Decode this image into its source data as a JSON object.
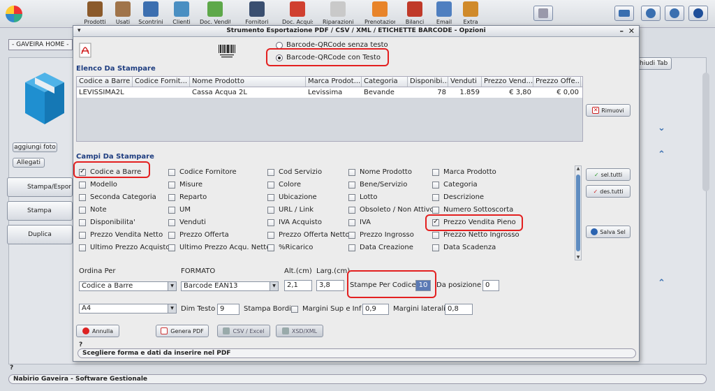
{
  "toolbar": {
    "items": [
      {
        "label": "Prodotti",
        "color": "#8b5a2b"
      },
      {
        "label": "Usati",
        "color": "#a0744a"
      },
      {
        "label": "Scontrini",
        "color": "#3c6fb0"
      },
      {
        "label": "Clienti",
        "color": "#4a8fc2"
      },
      {
        "label": "Doc. Vendita",
        "color": "#5ea84a"
      },
      {
        "label": "Fornitori",
        "color": "#3a4f70"
      },
      {
        "label": "Doc. Acquisto",
        "color": "#d04030"
      },
      {
        "label": "Riparazioni",
        "color": "#c9c9c9"
      },
      {
        "label": "Prenotazioni",
        "color": "#e8842a"
      },
      {
        "label": "Bilanci",
        "color": "#c03a2a"
      },
      {
        "label": "Email",
        "color": "#4f7fc0"
      },
      {
        "label": "Extra",
        "color": "#d08a2a"
      }
    ],
    "right_buttons": [
      "printer-icon",
      "keyboard-icon",
      "settings-icon",
      "minimize-icon",
      "power-icon"
    ]
  },
  "background": {
    "home_tab": "- GAVEIRA HOME -",
    "add_photo": "aggiungi foto",
    "attachments": "Allegati",
    "print_export": "Stampa/Espor",
    "print_labels": "Stampa Etichet",
    "duplicate": "Duplica",
    "close_tab": "Chiudi Tab",
    "status_q": "?",
    "status": "Nabirio Gaveira - Software Gestionale"
  },
  "dialog": {
    "title": "Strumento Esportazione PDF / CSV / XML / ETICHETTE BARCODE - Opzioni",
    "barcode_options": [
      {
        "label": "Barcode-QRCode senza testo",
        "selected": false
      },
      {
        "label": "Barcode-QRCode con Testo",
        "selected": true
      }
    ],
    "list_title": "Elenco Da Stampare",
    "table": {
      "columns": [
        "Codice a Barre",
        "Codice Fornit...",
        "Nome Prodotto",
        "Marca Prodot...",
        "Categoria",
        "Disponibi...",
        "Venduti",
        "Prezzo Vend...",
        "Prezzo Offe..."
      ],
      "rows": [
        [
          "LEVISSIMA2L",
          "",
          "Cassa Acqua 2L",
          "Levissima",
          "Bevande",
          "78",
          "1.859",
          "€ 3,80",
          "€ 0,00"
        ]
      ]
    },
    "remove_button": "Rimuovi",
    "fields_title": "Campi Da Stampare",
    "fields": [
      [
        {
          "label": "Codice a Barre",
          "checked": true
        },
        {
          "label": "Modello",
          "checked": false
        },
        {
          "label": "Seconda Categoria",
          "checked": false
        },
        {
          "label": "Note",
          "checked": false
        },
        {
          "label": "Disponibilita'",
          "checked": false
        },
        {
          "label": "Prezzo Vendita Netto",
          "checked": false
        },
        {
          "label": "Ultimo Prezzo Acquisto",
          "checked": false
        }
      ],
      [
        {
          "label": "Codice Fornitore",
          "checked": false
        },
        {
          "label": "Misure",
          "checked": false
        },
        {
          "label": "Reparto",
          "checked": false
        },
        {
          "label": "UM",
          "checked": false
        },
        {
          "label": "Venduti",
          "checked": false
        },
        {
          "label": "Prezzo Offerta",
          "checked": false
        },
        {
          "label": "Ultimo Prezzo Acqu. Netto",
          "checked": false
        }
      ],
      [
        {
          "label": "Cod Servizio",
          "checked": false
        },
        {
          "label": "Colore",
          "checked": false
        },
        {
          "label": "Ubicazione",
          "checked": false
        },
        {
          "label": "URL / Link",
          "checked": false
        },
        {
          "label": "IVA Acquisto",
          "checked": false
        },
        {
          "label": "Prezzo Offerta Netto",
          "checked": false
        },
        {
          "label": "%Ricarico",
          "checked": false
        }
      ],
      [
        {
          "label": "Nome Prodotto",
          "checked": false
        },
        {
          "label": "Bene/Servizio",
          "checked": false
        },
        {
          "label": "Lotto",
          "checked": false
        },
        {
          "label": "Obsoleto / Non Attivo",
          "checked": false
        },
        {
          "label": "IVA",
          "checked": false
        },
        {
          "label": "Prezzo Ingrosso",
          "checked": false
        },
        {
          "label": "Data Creazione",
          "checked": false
        }
      ],
      [
        {
          "label": "Marca Prodotto",
          "checked": false
        },
        {
          "label": "Categoria",
          "checked": false
        },
        {
          "label": "Descrizione",
          "checked": false
        },
        {
          "label": "Numero Sottoscorta",
          "checked": false
        },
        {
          "label": "Prezzo Vendita Pieno",
          "checked": true
        },
        {
          "label": "Prezzo Netto Ingrosso",
          "checked": false
        },
        {
          "label": "Data Scadenza",
          "checked": false
        }
      ]
    ],
    "select_all": "sel.tutti",
    "deselect_all": "des.tutti",
    "save_selection": "Salva Sel",
    "order_label": "Ordina Per",
    "order_value": "Codice a Barre",
    "format_label": "FORMATO",
    "format_value": "Barcode EAN13",
    "height_label": "Alt.(cm)",
    "height_value": "2,1",
    "width_label": "Larg.(cm)",
    "width_value": "3,8",
    "copies_label": "Stampe Per Codice",
    "copies_value": "10",
    "from_position_label": "Da posizione",
    "from_position_value": "0",
    "paper_value": "A4",
    "text_size_label": "Dim Testo",
    "text_size_value": "9",
    "print_borders_label": "Stampa Bordi",
    "margins_tb_label": "Margini Sup e Inf",
    "margins_tb_value": "0,9",
    "margins_side_label": "Margini laterali",
    "margins_side_value": "0,8",
    "cancel_button": "Annulla",
    "pdf_button": "Genera PDF",
    "csv_button": "CSV / Excel",
    "xml_button": "XSD/XML",
    "hint_q": "?",
    "hint": "Scegliere forma e dati da inserire nel PDF"
  }
}
